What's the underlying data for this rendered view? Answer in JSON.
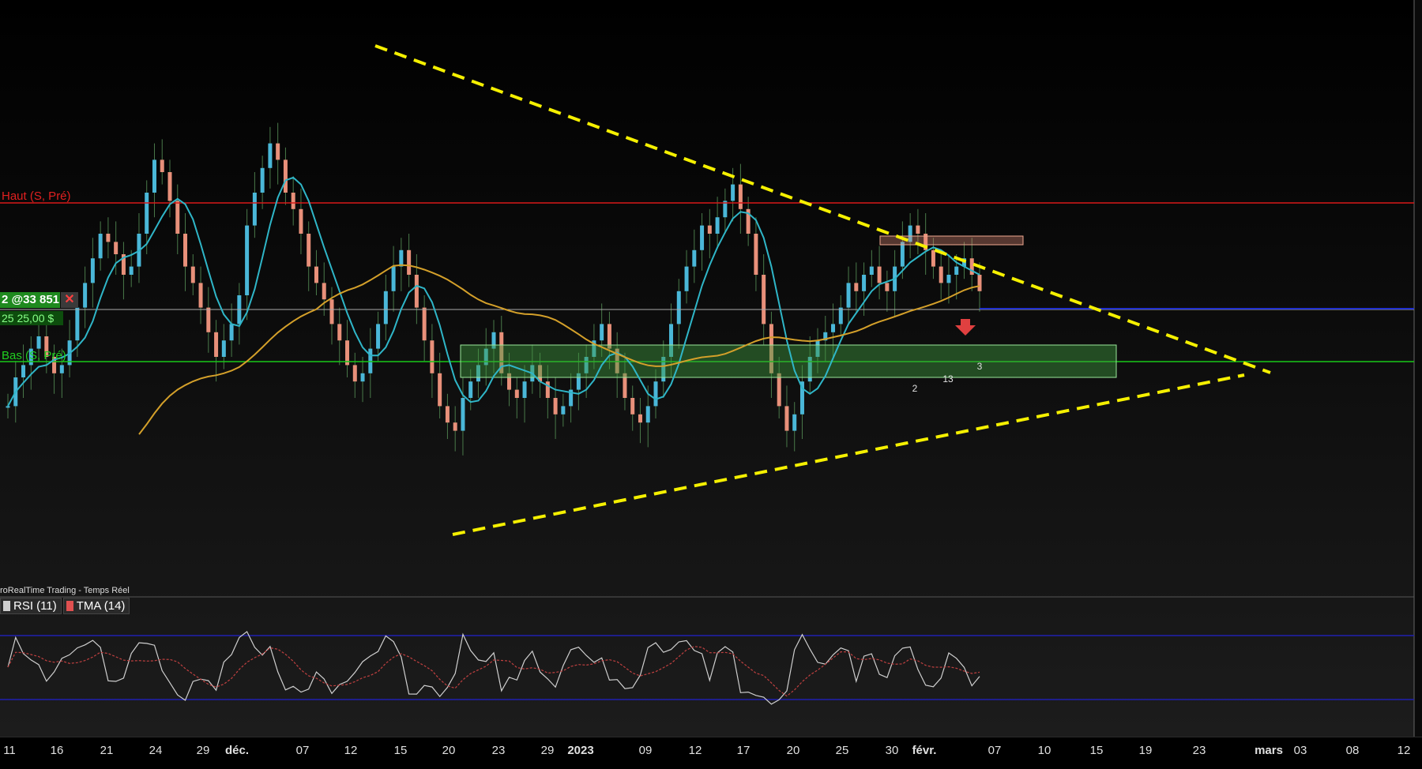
{
  "chart_data": {
    "type": "candlestick",
    "title": "",
    "source": "roRealTime Trading - Temps Réel",
    "x_tick_labels": [
      "11",
      "16",
      "21",
      "24",
      "29",
      "déc.",
      "07",
      "12",
      "15",
      "20",
      "23",
      "29",
      "2023",
      "09",
      "12",
      "17",
      "20",
      "25",
      "30",
      "févr.",
      "07",
      "10",
      "15",
      "19",
      "23",
      "mars",
      "03",
      "08",
      "12"
    ],
    "levels": {
      "haut_label": "Haut (S, Pré)",
      "bas_label": "Bas (S, Pré)"
    },
    "order": {
      "label": "2 @33 851",
      "sub_label": "25 25,00 $"
    },
    "indicators": {
      "rsi_label": "RSI (11)",
      "tma_label": "TMA (14)"
    },
    "signal_numbers": [
      "2",
      "13",
      "3"
    ],
    "candles": [
      28,
      35,
      38,
      42,
      45,
      40,
      36,
      38,
      44,
      52,
      58,
      64,
      70,
      68,
      65,
      60,
      62,
      70,
      80,
      88,
      85,
      78,
      70,
      62,
      58,
      52,
      46,
      40,
      44,
      48,
      55,
      72,
      80,
      86,
      92,
      88,
      80,
      76,
      70,
      62,
      58,
      54,
      48,
      44,
      38,
      34,
      36,
      42,
      48,
      56,
      62,
      66,
      60,
      52,
      44,
      36,
      28,
      24,
      22,
      30,
      34,
      38,
      42,
      46,
      36,
      32,
      30,
      34,
      38,
      34,
      30,
      26,
      28,
      32,
      36,
      40,
      44,
      48,
      42,
      36,
      30,
      26,
      24,
      28,
      34,
      40,
      48,
      56,
      62,
      66,
      72,
      70,
      74,
      78,
      82,
      76,
      70,
      60,
      48,
      36,
      28,
      22,
      26,
      34,
      40,
      44,
      46,
      48,
      52,
      58,
      56,
      60,
      62,
      58,
      56,
      62,
      68,
      72,
      70,
      66,
      62,
      58,
      60,
      62,
      64,
      60,
      56
    ],
    "colors": {
      "up": "#4ab7d8",
      "down": "#e8907a",
      "ma_fast": "#2fb6c8",
      "ma_slow": "#d4a02a",
      "triangle": "#f5f000",
      "haut_line": "#d81818",
      "bas_line": "#18c818",
      "zone_fill": "#3f9a3f",
      "rsi": "#cfcfcf",
      "tma": "#c04040"
    }
  }
}
